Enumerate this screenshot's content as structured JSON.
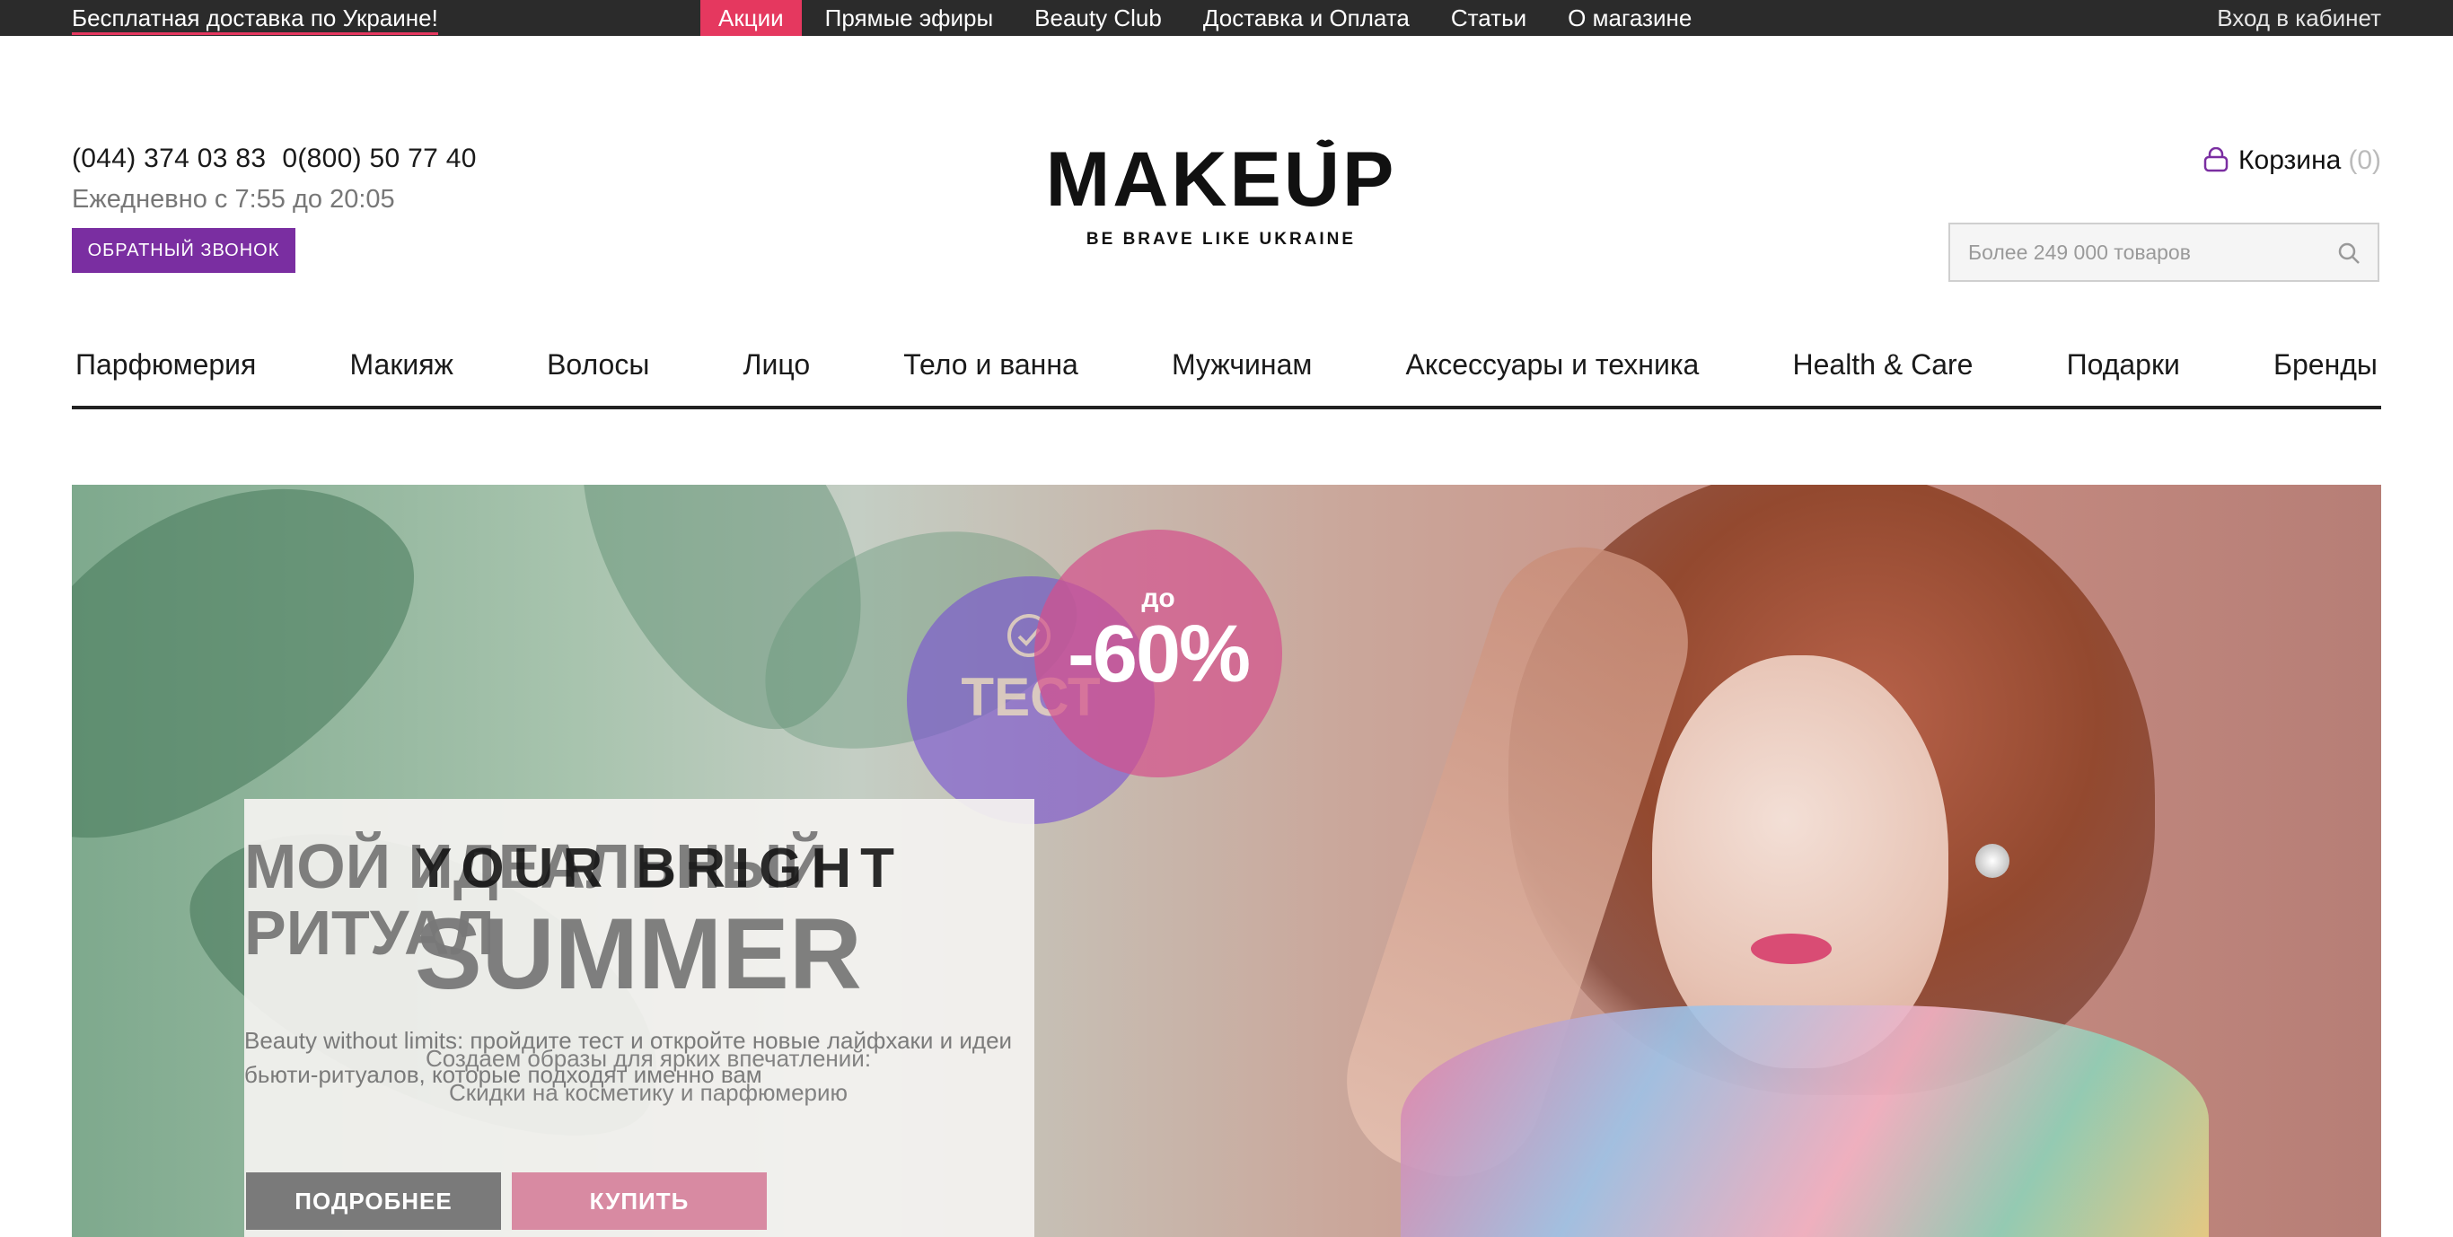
{
  "topbar": {
    "free_delivery": "Бесплатная доставка по Украине!",
    "nav": [
      "Акции",
      "Прямые эфиры",
      "Beauty Club",
      "Доставка и Оплата",
      "Статьи",
      "О магазине"
    ],
    "login": "Вход в кабинет"
  },
  "header": {
    "phone1": "(044) 374 03 83",
    "phone2": "0(800) 50 77 40",
    "hours": "Ежедневно с 7:55 до 20:05",
    "callback": "ОБРАТНЫЙ ЗВОНОК",
    "logo": "MAKEUP",
    "tagline": "BE BRAVE LIKE UKRAINE",
    "cart_label": "Корзина",
    "cart_count": "(0)",
    "search_placeholder": "Более 249 000 товаров"
  },
  "categories": [
    "Парфюмерия",
    "Макияж",
    "Волосы",
    "Лицо",
    "Тело и ванна",
    "Мужчинам",
    "Аксессуары и техника",
    "Health & Care",
    "Подарки",
    "Бренды"
  ],
  "banner": {
    "test_badge": "ТЕСТ",
    "sale_prefix": "до",
    "sale_value": "-60%",
    "title_ritual": "МОЙ ИДЕАЛЬНЫЙ РИТУАЛ",
    "title_your": "YOUR BRIGHT",
    "title_summer": "SUMMER",
    "desc_ritual": "Beauty without limits: пройдите тест и откройте новые лайфхаки и идеи бьюти-ритуалов, которые подходят именно вам",
    "desc_summer": "Создаем образы для ярких впечатлений: Скидки на косметику и парфюмерию",
    "btn_more": "ПОДРОБНЕЕ",
    "btn_buy": "КУПИТЬ"
  },
  "colors": {
    "accent_purple": "#7a2ea1",
    "accent_pink": "#e5385f",
    "topbar_bg": "#2b2b2b"
  }
}
